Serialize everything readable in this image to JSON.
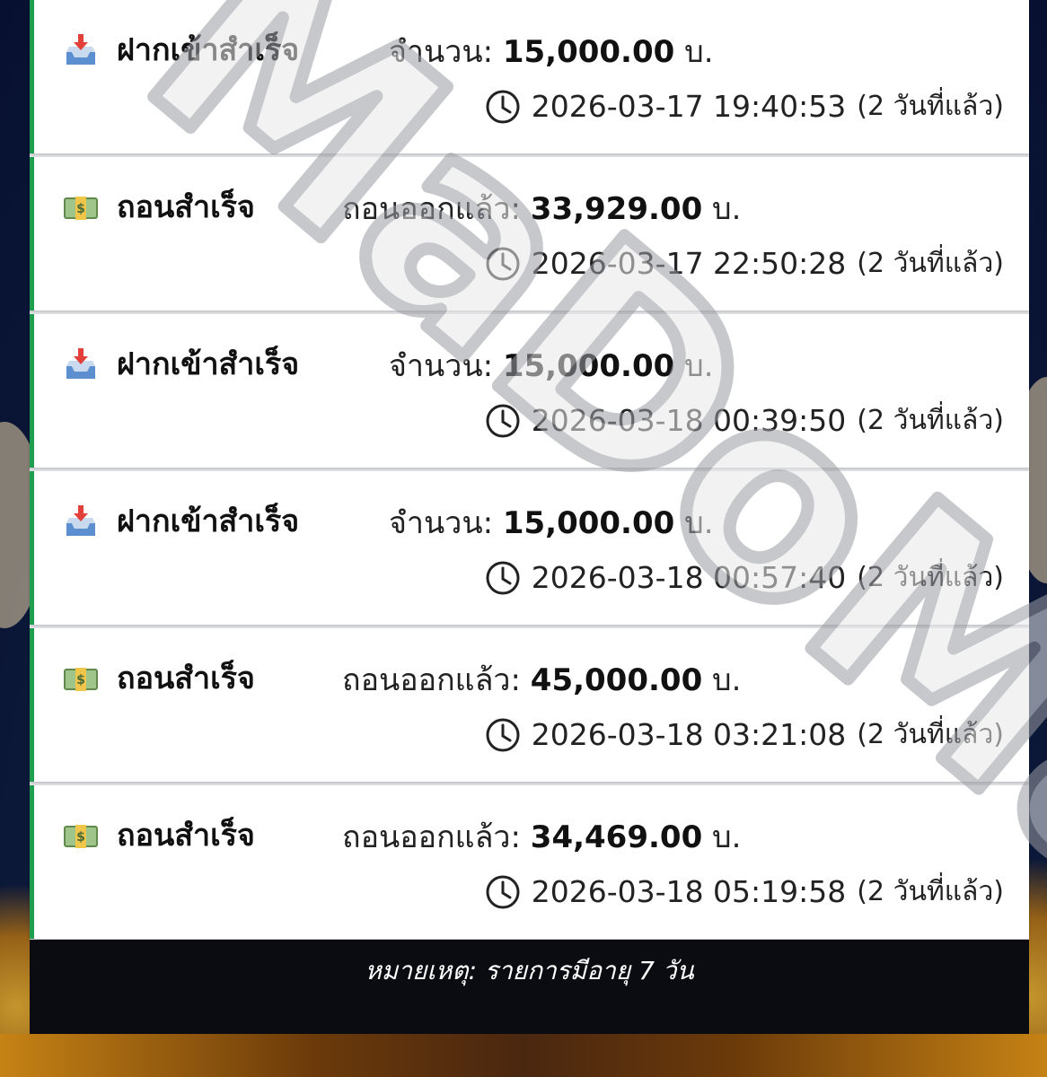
{
  "transactions": [
    {
      "type": "deposit",
      "status": "ฝากเข้าสำเร็จ",
      "amount_label": "จำนวน:",
      "amount": "15,000.00",
      "currency": "บ.",
      "datetime": "2026-03-17 19:40:53",
      "ago": "(2 วันที่แล้ว)"
    },
    {
      "type": "withdraw",
      "status": "ถอนสำเร็จ",
      "amount_label": "ถอนออกแล้ว:",
      "amount": "33,929.00",
      "currency": "บ.",
      "datetime": "2026-03-17 22:50:28",
      "ago": "(2 วันที่แล้ว)"
    },
    {
      "type": "deposit",
      "status": "ฝากเข้าสำเร็จ",
      "amount_label": "จำนวน:",
      "amount": "15,000.00",
      "currency": "บ.",
      "datetime": "2026-03-18 00:39:50",
      "ago": "(2 วันที่แล้ว)"
    },
    {
      "type": "deposit",
      "status": "ฝากเข้าสำเร็จ",
      "amount_label": "จำนวน:",
      "amount": "15,000.00",
      "currency": "บ.",
      "datetime": "2026-03-18 00:57:40",
      "ago": "(2 วันที่แล้ว)"
    },
    {
      "type": "withdraw",
      "status": "ถอนสำเร็จ",
      "amount_label": "ถอนออกแล้ว:",
      "amount": "45,000.00",
      "currency": "บ.",
      "datetime": "2026-03-18 03:21:08",
      "ago": "(2 วันที่แล้ว)"
    },
    {
      "type": "withdraw",
      "status": "ถอนสำเร็จ",
      "amount_label": "ถอนออกแล้ว:",
      "amount": "34,469.00",
      "currency": "บ.",
      "datetime": "2026-03-18 05:19:58",
      "ago": "(2 วันที่แล้ว)"
    }
  ],
  "footer_note": "หมายเหตุ: รายการมีอายุ 7 วัน",
  "watermark_text": "MaDoMan",
  "colors": {
    "accent_green": "#1f9e4f",
    "footer_bg": "#0a0c12"
  }
}
